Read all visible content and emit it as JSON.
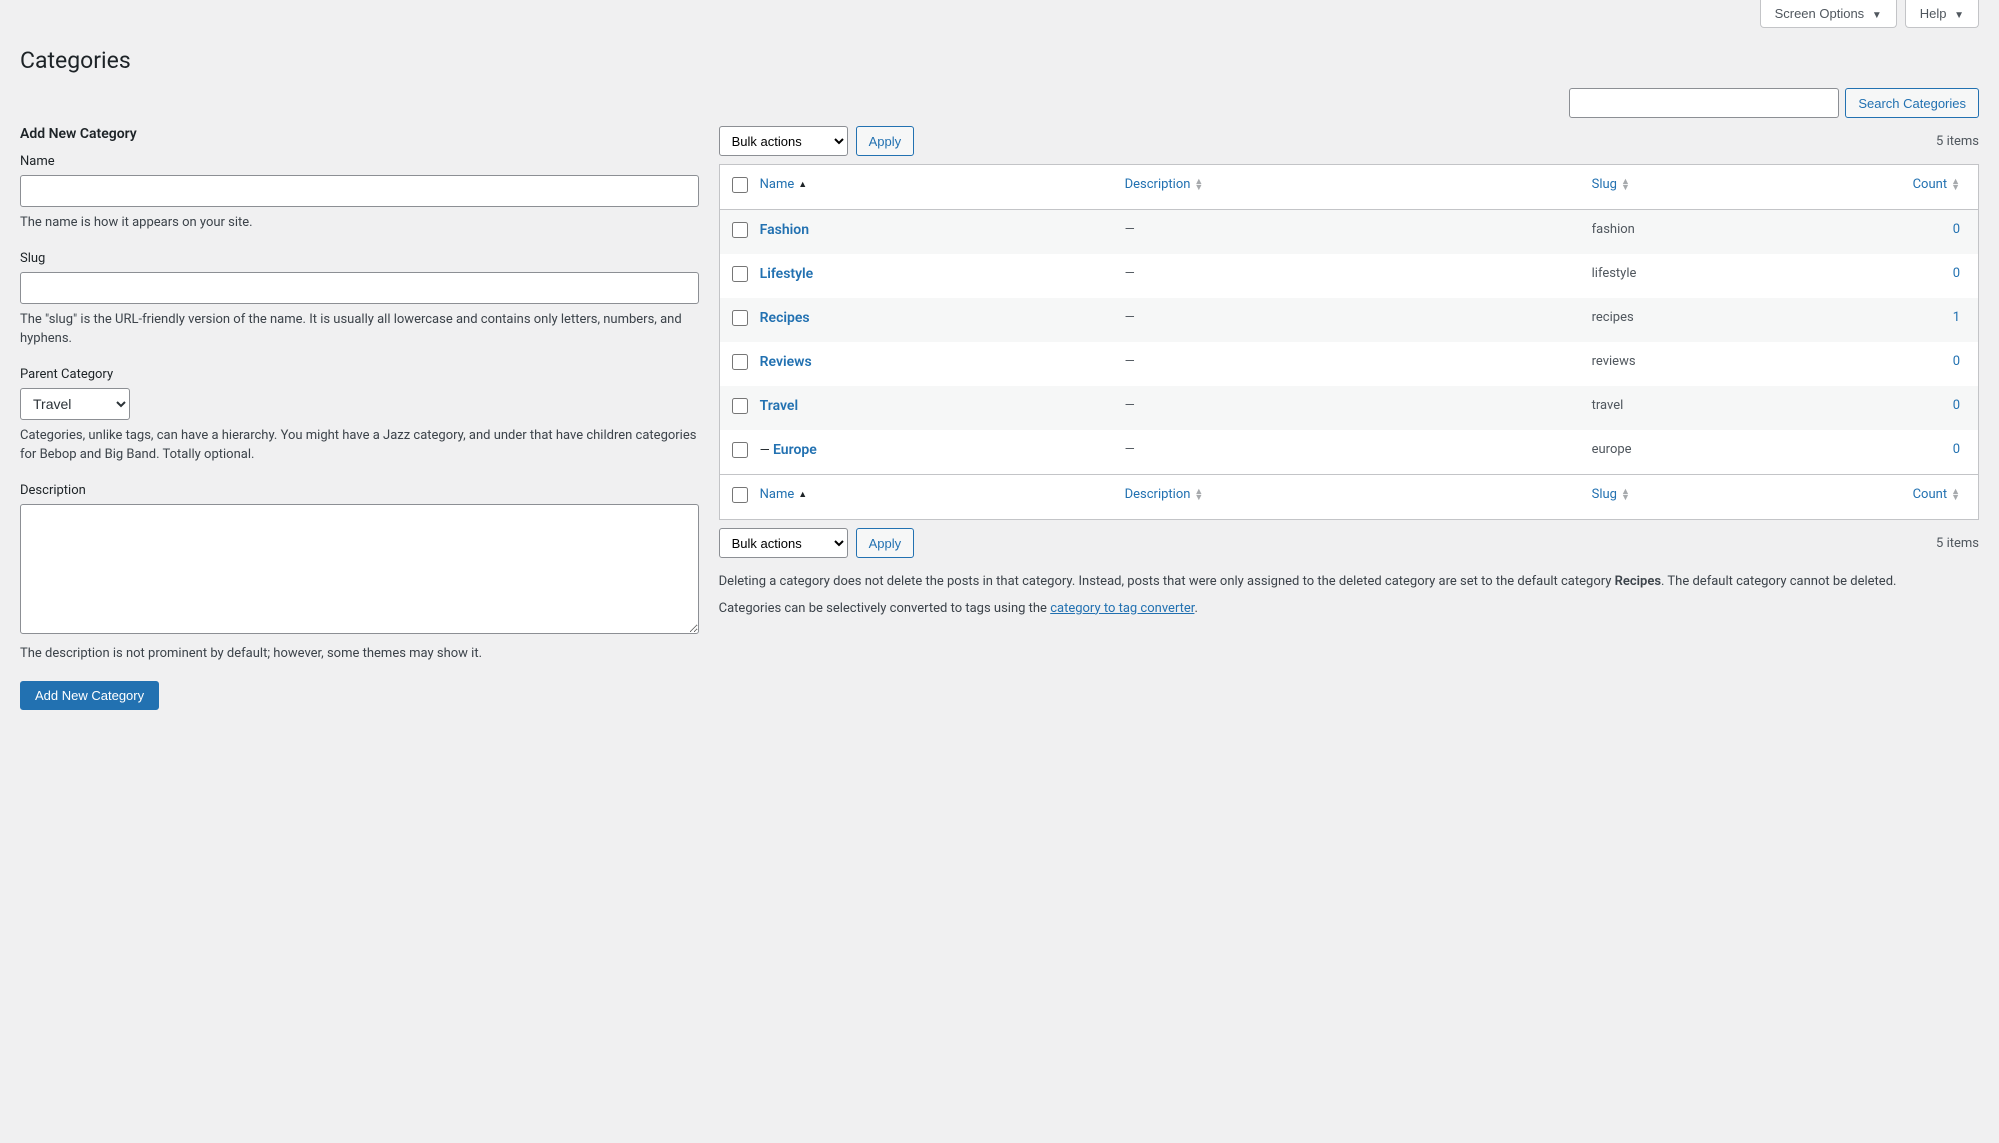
{
  "topbar": {
    "screen_options": "Screen Options",
    "help": "Help"
  },
  "page_title": "Categories",
  "search": {
    "button": "Search Categories"
  },
  "form": {
    "heading": "Add New Category",
    "name_label": "Name",
    "name_desc": "The name is how it appears on your site.",
    "slug_label": "Slug",
    "slug_desc": "The \"slug\" is the URL-friendly version of the name. It is usually all lowercase and contains only letters, numbers, and hyphens.",
    "parent_label": "Parent Category",
    "parent_value": "Travel",
    "parent_desc": "Categories, unlike tags, can have a hierarchy. You might have a Jazz category, and under that have children categories for Bebop and Big Band. Totally optional.",
    "desc_label": "Description",
    "desc_desc": "The description is not prominent by default; however, some themes may show it.",
    "submit": "Add New Category"
  },
  "bulk": {
    "label": "Bulk actions",
    "apply": "Apply"
  },
  "items_count": "5 items",
  "columns": {
    "name": "Name",
    "description": "Description",
    "slug": "Slug",
    "count": "Count"
  },
  "rows": [
    {
      "name": "Fashion",
      "indent": "",
      "desc": "—",
      "slug": "fashion",
      "count": "0"
    },
    {
      "name": "Lifestyle",
      "indent": "",
      "desc": "—",
      "slug": "lifestyle",
      "count": "0"
    },
    {
      "name": "Recipes",
      "indent": "",
      "desc": "—",
      "slug": "recipes",
      "count": "1"
    },
    {
      "name": "Reviews",
      "indent": "",
      "desc": "—",
      "slug": "reviews",
      "count": "0"
    },
    {
      "name": "Travel",
      "indent": "",
      "desc": "—",
      "slug": "travel",
      "count": "0"
    },
    {
      "name": "Europe",
      "indent": "— ",
      "desc": "—",
      "slug": "europe",
      "count": "0"
    }
  ],
  "notes": {
    "delete_prefix": "Deleting a category does not delete the posts in that category. Instead, posts that were only assigned to the deleted category are set to the default category ",
    "default_cat": "Recipes",
    "delete_suffix": ". The default category cannot be deleted.",
    "convert_prefix": "Categories can be selectively converted to tags using the ",
    "convert_link": "category to tag converter",
    "convert_suffix": "."
  }
}
